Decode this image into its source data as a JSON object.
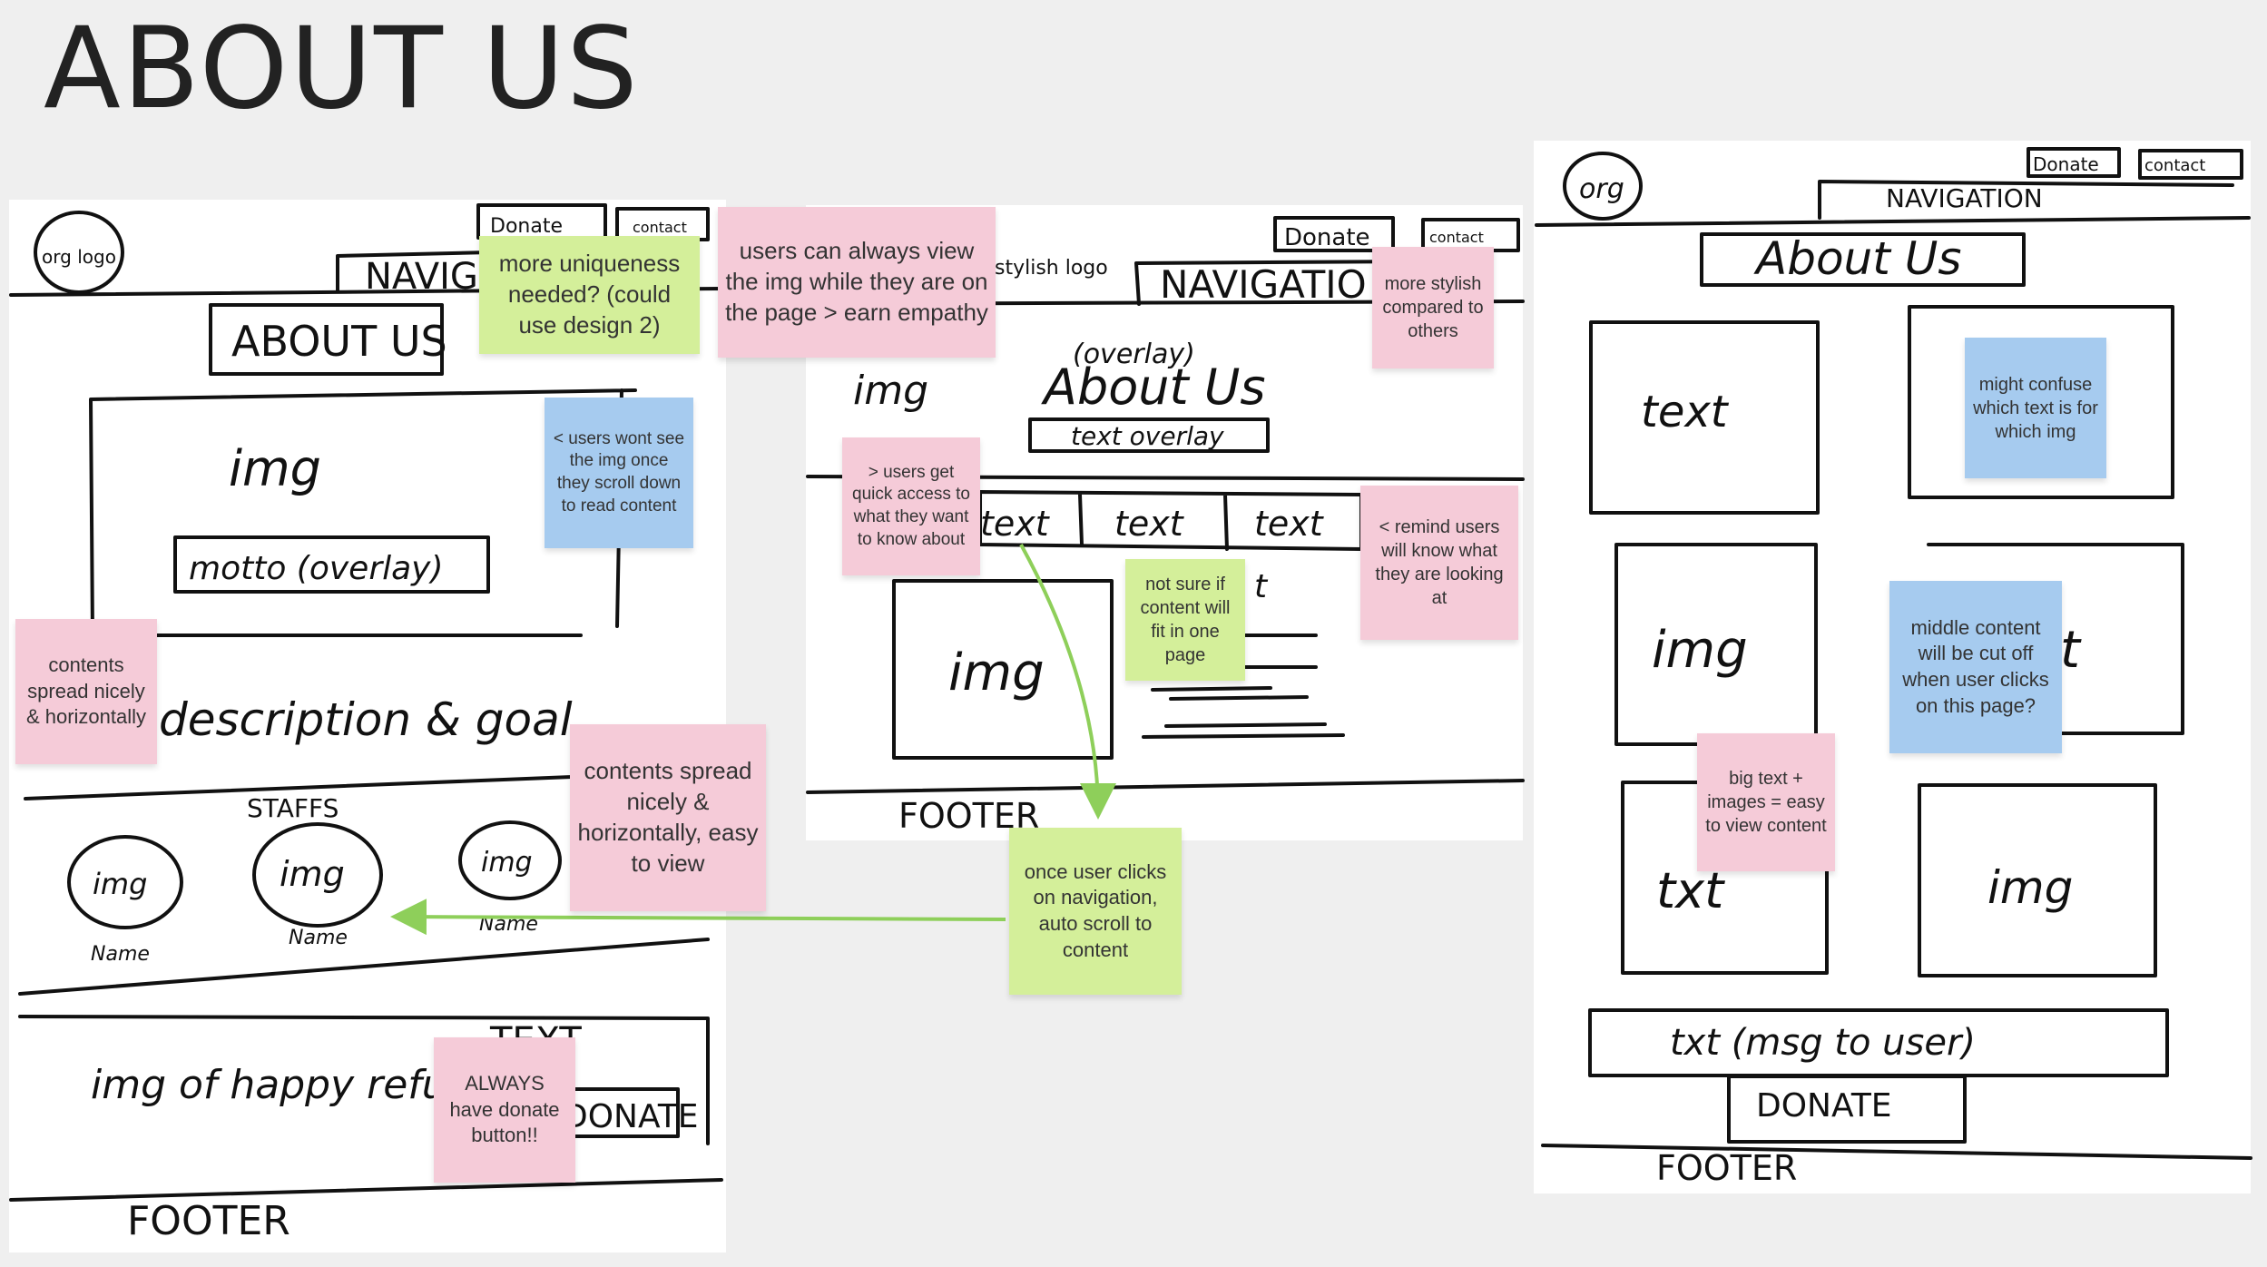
{
  "page": {
    "title": "ABOUT US"
  },
  "sketch_1": {
    "logo": "org logo",
    "donate": "Donate",
    "contact": "contact",
    "navigation": "NAVIG",
    "about_us": "ABOUT US",
    "img": "img",
    "motto": "motto (overlay)",
    "description": "description & goal",
    "staffs": "STAFFS",
    "staff_img": "img",
    "staff_name": "Name",
    "happy_img": "img of happy refugee",
    "text": "TEXT",
    "donate_btn": "DONATE",
    "footer": "FOOTER"
  },
  "sketch_2": {
    "logo": "stylish logo",
    "donate": "Donate",
    "contact": "contact",
    "navigation": "NAVIGATIO",
    "overlay": "(overlay)",
    "about_us": "About Us",
    "img": "img",
    "text_overlay": "text overlay",
    "text_tabs": [
      "text",
      "text",
      "text"
    ],
    "text_fragment": "t",
    "img_box": "img",
    "footer": "FOOTER"
  },
  "sketch_3": {
    "logo": "org",
    "donate": "Donate",
    "contact": "contact",
    "navigation": "NAVIGATION",
    "about_us": "About Us",
    "cells": [
      "text",
      "img",
      "img",
      "t",
      "txt",
      "img"
    ],
    "bottom_text": "txt (msg to user)",
    "donate_btn": "DONATE",
    "footer": "FOOTER"
  },
  "notes": [
    {
      "id": "n1",
      "color": "green",
      "text": "more uniqueness needed? (could use design 2)"
    },
    {
      "id": "n2",
      "color": "pink",
      "text": "users can always view the img while they are on the page > earn empathy"
    },
    {
      "id": "n3",
      "color": "pink",
      "text": "more stylish compared to others"
    },
    {
      "id": "n4",
      "color": "blue",
      "text": "< users wont see the img once they scroll down to read content"
    },
    {
      "id": "n5",
      "color": "pink",
      "text": "> users get quick access to what they want to know about"
    },
    {
      "id": "n6",
      "color": "pink",
      "text": "< remind users will know what they are looking at"
    },
    {
      "id": "n7",
      "color": "green",
      "text": "not sure if content will fit in one page"
    },
    {
      "id": "n8",
      "color": "pink",
      "text": "contents spread nicely & horizontally"
    },
    {
      "id": "n9",
      "color": "pink",
      "text": "contents spread nicely & horizontally, easy to view"
    },
    {
      "id": "n10",
      "color": "green",
      "text": "once user clicks on navigation, auto scroll to content"
    },
    {
      "id": "n11",
      "color": "pink",
      "text": "ALWAYS have donate button!!"
    },
    {
      "id": "n12",
      "color": "blue",
      "text": "might confuse which text is for which img"
    },
    {
      "id": "n13",
      "color": "blue",
      "text": "middle content will be cut off when user clicks on this page?"
    },
    {
      "id": "n14",
      "color": "pink",
      "text": "big text + images = easy to view content"
    }
  ],
  "colors": {
    "green": "#d4ef9a",
    "pink": "#f5cbd8",
    "blue": "#a6cbef",
    "arrow": "#8ecf5a",
    "ink": "#111111"
  }
}
